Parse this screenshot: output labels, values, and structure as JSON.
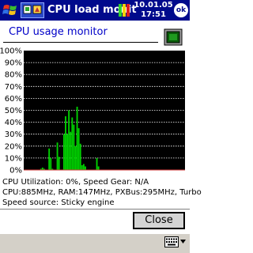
{
  "titlebar": {
    "title": "CPU load monit",
    "date": "10.01.05",
    "time": "17:51",
    "ok_label": "ok",
    "colors": {
      "background": "#000a8c",
      "text": "#ffffff"
    }
  },
  "header": {
    "title": "CPU usage monitor",
    "title_color": "#0000c8"
  },
  "chart_data": {
    "type": "area",
    "y_tick_labels": [
      "100%",
      "90%",
      "80%",
      "70%",
      "60%",
      "50%",
      "40%",
      "30%",
      "20%",
      "10%",
      "0%"
    ],
    "ylim": [
      0,
      100
    ],
    "grid": true,
    "background": "#000000",
    "gridline_color": "#ffffff",
    "series": [
      {
        "color": "#00d200",
        "values": [
          0,
          0,
          0,
          0,
          0,
          0,
          0,
          0,
          0,
          0,
          1,
          2,
          1,
          0,
          0,
          18,
          10,
          1,
          0,
          0,
          23,
          11,
          0,
          0,
          30,
          45,
          30,
          50,
          32,
          44,
          38,
          20,
          53,
          35,
          22,
          4,
          5,
          3,
          0,
          0,
          0,
          0,
          0,
          0,
          10,
          3,
          0,
          0,
          0,
          0,
          0,
          0,
          0,
          0,
          0,
          0,
          0,
          0,
          0,
          0,
          0,
          0,
          0,
          0,
          0,
          0,
          0,
          0,
          0,
          0,
          0,
          0,
          0,
          0,
          0,
          0,
          0,
          0,
          0,
          0,
          0,
          0,
          0,
          0,
          0,
          0,
          0,
          0,
          0,
          0,
          0,
          0,
          0,
          0,
          0,
          0,
          0,
          0
        ]
      }
    ]
  },
  "info": {
    "line1": "CPU Utilization: 0%, Speed Gear: N/A",
    "line2": "CPU:885MHz, RAM:147MHz, PXBus:295MHz, Turbo",
    "line3": "Speed source: Sticky engine"
  },
  "buttons": {
    "close_label": "Close"
  },
  "cmdbar": {
    "input_icon": "keyboard-icon"
  }
}
